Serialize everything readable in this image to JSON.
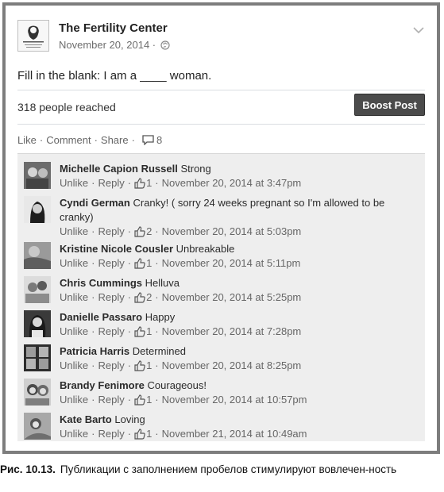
{
  "post": {
    "page_name": "The Fertility Center",
    "date": "November 20, 2014",
    "date_sep": " · ",
    "text": "Fill in the blank: I am a ____ woman.",
    "reached": "318 people reached",
    "boost_label": "Boost Post",
    "actions": {
      "like": "Like",
      "comment": "Comment",
      "share": "Share",
      "comment_count": "8"
    }
  },
  "comments": [
    {
      "name": "Michelle Capion Russell",
      "text": "Strong",
      "unlike": "Unlike",
      "reply": "Reply",
      "likes": "1",
      "time": "November 20, 2014 at 3:47pm"
    },
    {
      "name": "Cyndi German",
      "text": "Cranky! ( sorry 24 weeks pregnant so I'm allowed to be cranky)",
      "unlike": "Unlike",
      "reply": "Reply",
      "likes": "2",
      "time": "November 20, 2014 at 5:03pm"
    },
    {
      "name": "Kristine Nicole Cousler",
      "text": "Unbreakable",
      "unlike": "Unlike",
      "reply": "Reply",
      "likes": "1",
      "time": "November 20, 2014 at 5:11pm"
    },
    {
      "name": "Chris Cummings",
      "text": "Helluva",
      "unlike": "Unlike",
      "reply": "Reply",
      "likes": "2",
      "time": "November 20, 2014 at 5:25pm"
    },
    {
      "name": "Danielle Passaro",
      "text": "Happy",
      "unlike": "Unlike",
      "reply": "Reply",
      "likes": "1",
      "time": "November 20, 2014 at 7:28pm"
    },
    {
      "name": "Patricia Harris",
      "text": "Determined",
      "unlike": "Unlike",
      "reply": "Reply",
      "likes": "1",
      "time": "November 20, 2014 at 8:25pm"
    },
    {
      "name": "Brandy Fenimore",
      "text": "Courageous!",
      "unlike": "Unlike",
      "reply": "Reply",
      "likes": "1",
      "time": "November 20, 2014 at 10:57pm"
    },
    {
      "name": "Kate Barto",
      "text": "Loving",
      "unlike": "Unlike",
      "reply": "Reply",
      "likes": "1",
      "time": "November 21, 2014 at 10:49am"
    }
  ],
  "caption": {
    "label": "Рис. 10.13.",
    "text": "Публикации с заполнением пробелов стимулируют вовлечен-ность"
  }
}
